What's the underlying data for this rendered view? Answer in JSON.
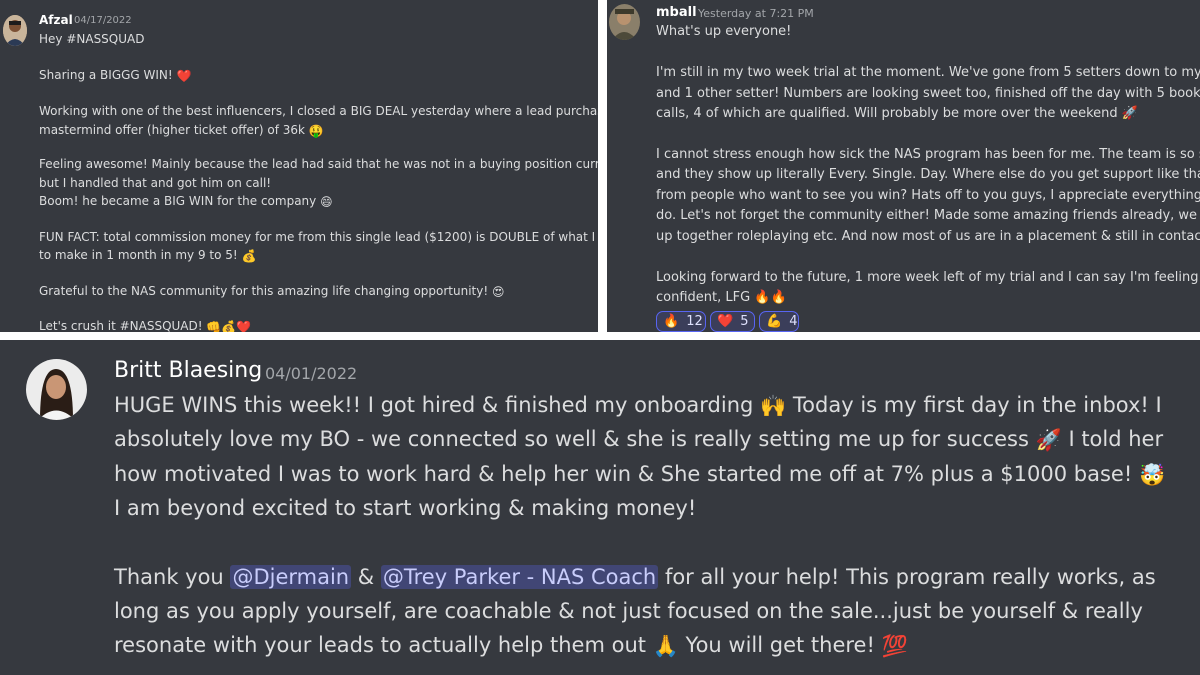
{
  "panel1": {
    "username": "Afzal",
    "timestamp": "04/17/2022",
    "lines": [
      "Hey #NASSQUAD",
      "Sharing a BIGGG WIN!",
      "Working with one of the best influencers, I closed a BIG DEAL yesterday where a lead purchased the",
      "mastermind offer (higher ticket offer) of 36k",
      "Feeling awesome! Mainly because the lead had said that he was not in a buying position currently,",
      "but I handled that and got him on call!",
      "Boom! he became a BIG WIN for the company",
      "FUN FACT: total commission money for me from this single lead ($1200) is DOUBLE of what I used",
      "to make in 1 month in my 9 to 5!",
      "Grateful to the NAS community for this amazing life changing opportunity!",
      "Let's crush it #NASSQUAD!"
    ]
  },
  "panel2": {
    "username": "mball",
    "timestamp": "Yesterday at 7:21 PM",
    "lines": [
      "What's up everyone!",
      "I'm still in my two week trial at the moment. We've gone from 5 setters down to myself",
      "and 1 other setter! Numbers are looking sweet too, finished off the day with 5 booked",
      "calls, 4 of which are qualified. Will probably be more over the weekend",
      "I cannot stress enough how sick the NAS program has been for me. The team is so solid",
      "and they show up literally Every. Single. Day. Where else do you get support like that",
      "from people who want to see you win? Hats off to you guys, I appreciate everything you",
      "do. Let's not forget the community either! Made some amazing friends already, we came",
      "up together roleplaying etc. And now most of us are in a placement & still in contact.",
      "Looking forward to the future, 1 more week left of my trial and I can say I'm feeling super",
      "confident, LFG"
    ],
    "reactions": [
      {
        "emoji": "🔥",
        "count": "12"
      },
      {
        "emoji": "❤️",
        "count": "5"
      },
      {
        "emoji": "💪",
        "count": "4"
      }
    ]
  },
  "panel3": {
    "username": "Britt Blaesing",
    "timestamp": "04/01/2022",
    "lines": [
      "HUGE WINS this week!! I got hired & finished my onboarding",
      "Today is my first day in the inbox! I",
      "absolutely love my BO - we connected so well & she is really setting me up for success",
      "I told her",
      "how motivated I was to work hard & help her win & She started me off at 7% plus a $1000 base!",
      "I am beyond excited to start working & making money!",
      "Thank you",
      "@Djermain",
      "&",
      "@Trey Parker - NAS Coach",
      "for all your help! This program really works, as",
      "long as you apply yourself, are coachable & not just focused on the sale...just be yourself & really",
      "resonate with your leads to actually help them out",
      "You will get there!"
    ]
  },
  "emojis": {
    "heart": "❤️",
    "money_face": "🤑",
    "grin": "😄",
    "money_bag": "💰",
    "heart_eyes": "😍",
    "fist": "👊",
    "rocket": "🚀",
    "fire": "🔥",
    "raised_hands": "🙌",
    "mind_blown": "🤯",
    "pray": "🙏",
    "hundred": "💯"
  },
  "colors": {
    "background": "#36393f",
    "text": "#dcddde",
    "timestamp": "#a3a6aa",
    "mention_bg": "#414675",
    "reaction_border": "#5865f2"
  }
}
